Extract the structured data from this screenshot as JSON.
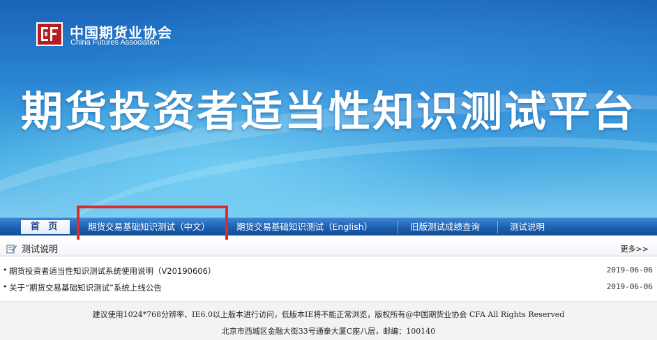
{
  "header": {
    "logo_cn": "中国期货业协会",
    "logo_en": "China Futures Association",
    "logo_icon": "cfa-logo-icon",
    "banner_title": "期货投资者适当性知识测试平台"
  },
  "nav": {
    "home_label": "首 页",
    "items": [
      {
        "label": "期货交易基础知识测试（中文）"
      },
      {
        "label": "期货交易基础知识测试（English）"
      },
      {
        "label": "旧版测试成绩查询"
      },
      {
        "label": "测试说明"
      }
    ]
  },
  "notices": {
    "section_icon": "document-pen-icon",
    "section_title": "测试说明",
    "more_label": "更多>>",
    "items": [
      {
        "title": "期货投资者适当性知识测试系统使用说明（V20190606）",
        "date": "2019-06-06"
      },
      {
        "title": "关于“期货交易基础知识测试”系统上线公告",
        "date": "2019-06-06"
      }
    ]
  },
  "footer": {
    "line1": "建议使用1024*768分辨率、IE6.0以上版本进行访问，低版本IE将不能正常浏览，版权所有@中国期货业协会 CFA All Rights Reserved",
    "line2": "北京市西城区金融大街33号通泰大厦C座八层，邮编：100140"
  },
  "colors": {
    "brand_red": "#b41e22",
    "nav_blue": "#1c5eaf",
    "highlight_red": "#e02a2a"
  }
}
